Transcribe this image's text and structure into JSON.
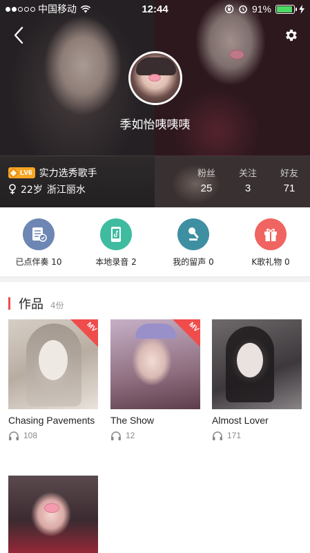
{
  "status_bar": {
    "carrier": "中国移动",
    "time": "12:44",
    "battery": "91%",
    "battery_level": 0.91
  },
  "profile": {
    "name": "季如怡咦咦咦",
    "level_badge": "LV6",
    "title": "实力选秀歌手",
    "age": "22岁",
    "location": "浙江丽水"
  },
  "stats": [
    {
      "label": "粉丝",
      "value": "25"
    },
    {
      "label": "关注",
      "value": "3"
    },
    {
      "label": "好友",
      "value": "71"
    }
  ],
  "actions": [
    {
      "label": "已点伴奏 10",
      "icon": "accompaniment-icon",
      "color": "#6e86b4"
    },
    {
      "label": "本地录音 2",
      "icon": "local-recording-icon",
      "color": "#3fbba0"
    },
    {
      "label": "我的留声 0",
      "icon": "microphone-icon",
      "color": "#3e8fa1"
    },
    {
      "label": "K歌礼物 0",
      "icon": "gift-icon",
      "color": "#f06461"
    }
  ],
  "works": {
    "heading": "作品",
    "count": "4份",
    "mv_label": "MV",
    "items": [
      {
        "title": "Chasing Pavements",
        "plays": "108",
        "mv": true
      },
      {
        "title": "The Show",
        "plays": "12",
        "mv": true
      },
      {
        "title": "Almost Lover",
        "plays": "171",
        "mv": false
      },
      {
        "title": "",
        "plays": "",
        "mv": false
      }
    ]
  },
  "colors": {
    "accent_red": "#f04c4c",
    "badge_orange": "#f6a623",
    "battery_green": "#4cd964"
  }
}
